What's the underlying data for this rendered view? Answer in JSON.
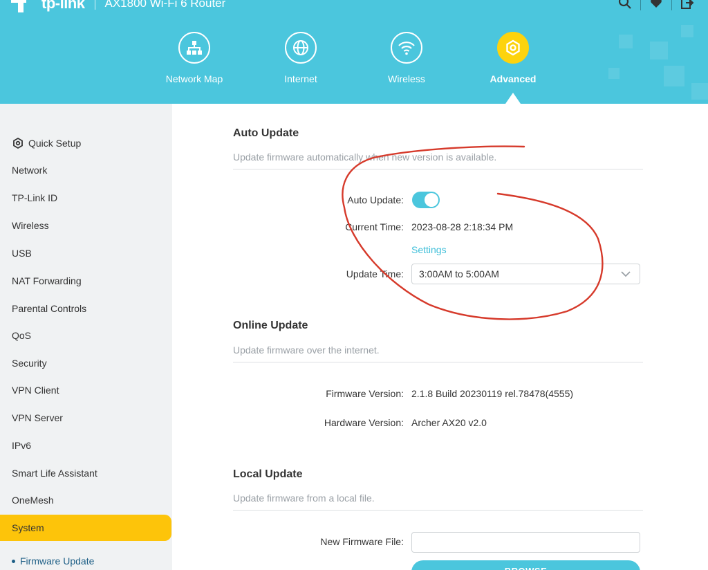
{
  "header": {
    "brand": "tp-link",
    "model": "AX1800 Wi-Fi 6 Router",
    "nav": [
      {
        "label": "Network Map",
        "icon": "network-map-icon"
      },
      {
        "label": "Internet",
        "icon": "globe-icon"
      },
      {
        "label": "Wireless",
        "icon": "wifi-icon"
      },
      {
        "label": "Advanced",
        "icon": "gear-icon",
        "active": true
      }
    ],
    "accent_color": "#4bc6dd",
    "active_color": "#fdd30d"
  },
  "sidebar": {
    "items": [
      {
        "label": "Quick Setup"
      },
      {
        "label": "Network"
      },
      {
        "label": "TP-Link ID"
      },
      {
        "label": "Wireless"
      },
      {
        "label": "USB"
      },
      {
        "label": "NAT Forwarding"
      },
      {
        "label": "Parental Controls"
      },
      {
        "label": "QoS"
      },
      {
        "label": "Security"
      },
      {
        "label": "VPN Client"
      },
      {
        "label": "VPN Server"
      },
      {
        "label": "IPv6"
      },
      {
        "label": "Smart Life Assistant"
      },
      {
        "label": "OneMesh"
      },
      {
        "label": "System",
        "active": true
      }
    ],
    "subitem": "Firmware Update"
  },
  "auto_update": {
    "title": "Auto Update",
    "desc": "Update firmware automatically when new version is available.",
    "toggle_label": "Auto Update:",
    "current_time_label": "Current Time:",
    "current_time": "2023-08-28 2:18:34 PM",
    "settings_link": "Settings",
    "update_time_label": "Update Time:",
    "update_time": "3:00AM to 5:00AM"
  },
  "online_update": {
    "title": "Online Update",
    "desc": "Update firmware over the internet.",
    "firmware_label": "Firmware Version:",
    "firmware_value": "2.1.8 Build 20230119 rel.78478(4555)",
    "hardware_label": "Hardware Version:",
    "hardware_value": "Archer AX20 v2.0"
  },
  "local_update": {
    "title": "Local Update",
    "desc": "Update firmware from a local file.",
    "file_label": "New Firmware File:",
    "browse_label": "BROWSE"
  }
}
